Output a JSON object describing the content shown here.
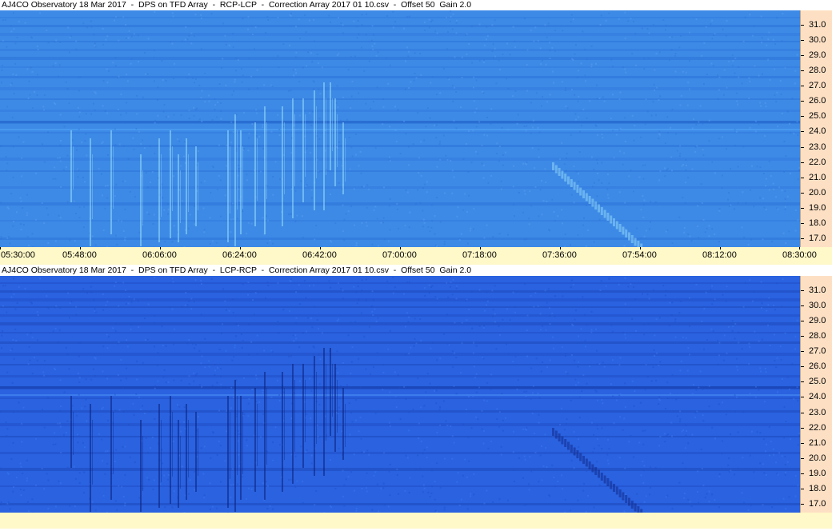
{
  "panels": [
    {
      "title": "AJ4CO Observatory 18 Mar 2017  -  DPS on TFD Array  -  RCP-LCP  -  Correction Array 2017 01 10.csv  -  Offset 50  Gain 2.0",
      "mode": "light",
      "base_color": "#3d8ae6",
      "streak_color": "#aef0ff"
    },
    {
      "title": "AJ4CO Observatory 18 Mar 2017  -  DPS on TFD Array  -  LCP-RCP  -  Correction Array 2017 01 10.csv  -  Offset 50  Gain 2.0",
      "mode": "dark",
      "base_color": "#2a62e0",
      "streak_color": "#0a1f7a"
    }
  ],
  "y_axis_labels": [
    "31.0",
    "30.0",
    "29.0",
    "28.0",
    "27.0",
    "26.0",
    "25.0",
    "24.0",
    "23.0",
    "22.0",
    "21.0",
    "20.0",
    "19.0",
    "18.0",
    "17.0"
  ],
  "x_axis_labels": [
    "05:30:00",
    "05:48:00",
    "06:06:00",
    "06:24:00",
    "06:42:00",
    "07:00:00",
    "07:18:00",
    "07:36:00",
    "07:54:00",
    "08:12:00",
    "08:30:00"
  ],
  "colors": {
    "y_axis_bg": "#fde0c4",
    "x_axis_bg": "#fff8c8"
  }
}
